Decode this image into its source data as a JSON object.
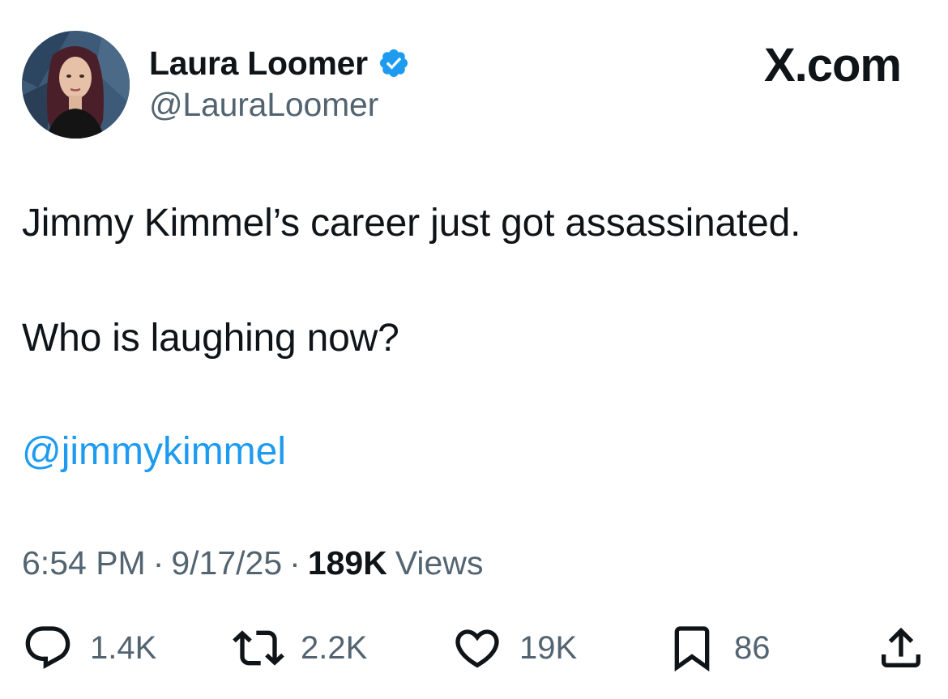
{
  "author": {
    "display_name": "Laura Loomer",
    "handle": "@LauraLoomer",
    "verified": true,
    "verified_color": "#1d9bf0"
  },
  "brand": {
    "label": "X.com"
  },
  "tweet": {
    "line1": "Jimmy Kimmel’s career just got assassinated.",
    "line2": "Who is laughing now?",
    "mention": "@jimmykimmel"
  },
  "meta": {
    "time": "6:54 PM",
    "date": "9/17/25",
    "separator": "·",
    "views_count": "189K",
    "views_label": "Views"
  },
  "actions": {
    "reply": {
      "icon": "reply-icon",
      "count": "1.4K"
    },
    "retweet": {
      "icon": "retweet-icon",
      "count": "2.2K"
    },
    "like": {
      "icon": "heart-icon",
      "count": "19K"
    },
    "bookmark": {
      "icon": "bookmark-icon",
      "count": "86"
    },
    "share": {
      "icon": "share-icon"
    }
  },
  "colors": {
    "text_primary": "#0f1419",
    "text_secondary": "#536471",
    "link": "#1d9bf0"
  }
}
